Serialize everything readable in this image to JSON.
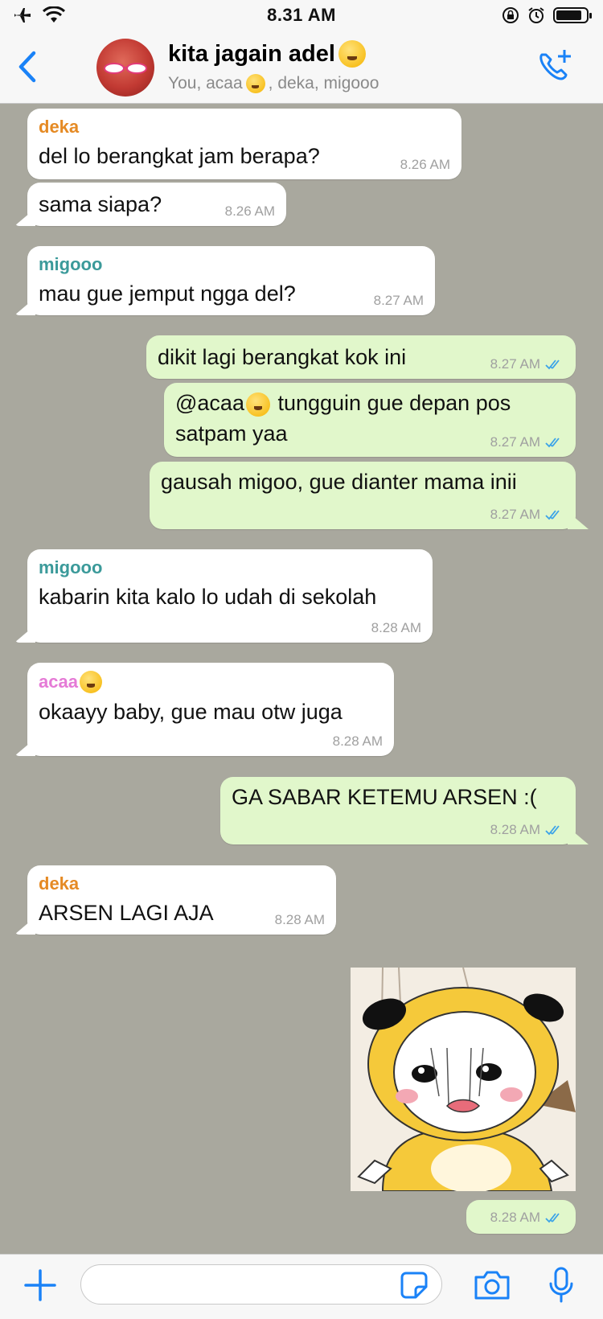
{
  "status_bar": {
    "time": "8.31 AM"
  },
  "header": {
    "title": "kita jagain adel",
    "subtitle_prefix": "You, acaa",
    "subtitle_suffix": ", deka, migooo"
  },
  "messages": [
    {
      "sender": "deka",
      "text": "del lo berangkat jam berapa?",
      "time": "8.26 AM"
    },
    {
      "text": "sama siapa?",
      "time": "8.26 AM"
    },
    {
      "sender": "migooo",
      "text": "mau gue jemput ngga del?",
      "time": "8.27 AM"
    },
    {
      "text": "dikit lagi berangkat kok ini",
      "time": "8.27 AM"
    },
    {
      "text_prefix": "@acaa",
      "text_suffix": " tungguin gue depan pos",
      "text_line2": "satpam yaa",
      "time": "8.27 AM"
    },
    {
      "text": "gausah migoo, gue dianter mama inii",
      "time": "8.27 AM"
    },
    {
      "sender": "migooo",
      "text": "kabarin kita kalo lo udah di sekolah",
      "time": "8.28 AM"
    },
    {
      "sender": "acaa",
      "text": "okaayy baby, gue mau otw juga",
      "time": "8.28 AM"
    },
    {
      "text": "GA SABAR KETEMU ARSEN :(",
      "time": "8.28 AM"
    },
    {
      "sender": "deka",
      "text": "ARSEN LAGI AJA",
      "time": "8.28 AM"
    },
    {
      "time": "8.28 AM"
    }
  ],
  "colors": {
    "deka": "#e58a24",
    "migooo": "#3b9a9a",
    "acaa": "#e57ad6",
    "accent": "#1a82f7"
  }
}
